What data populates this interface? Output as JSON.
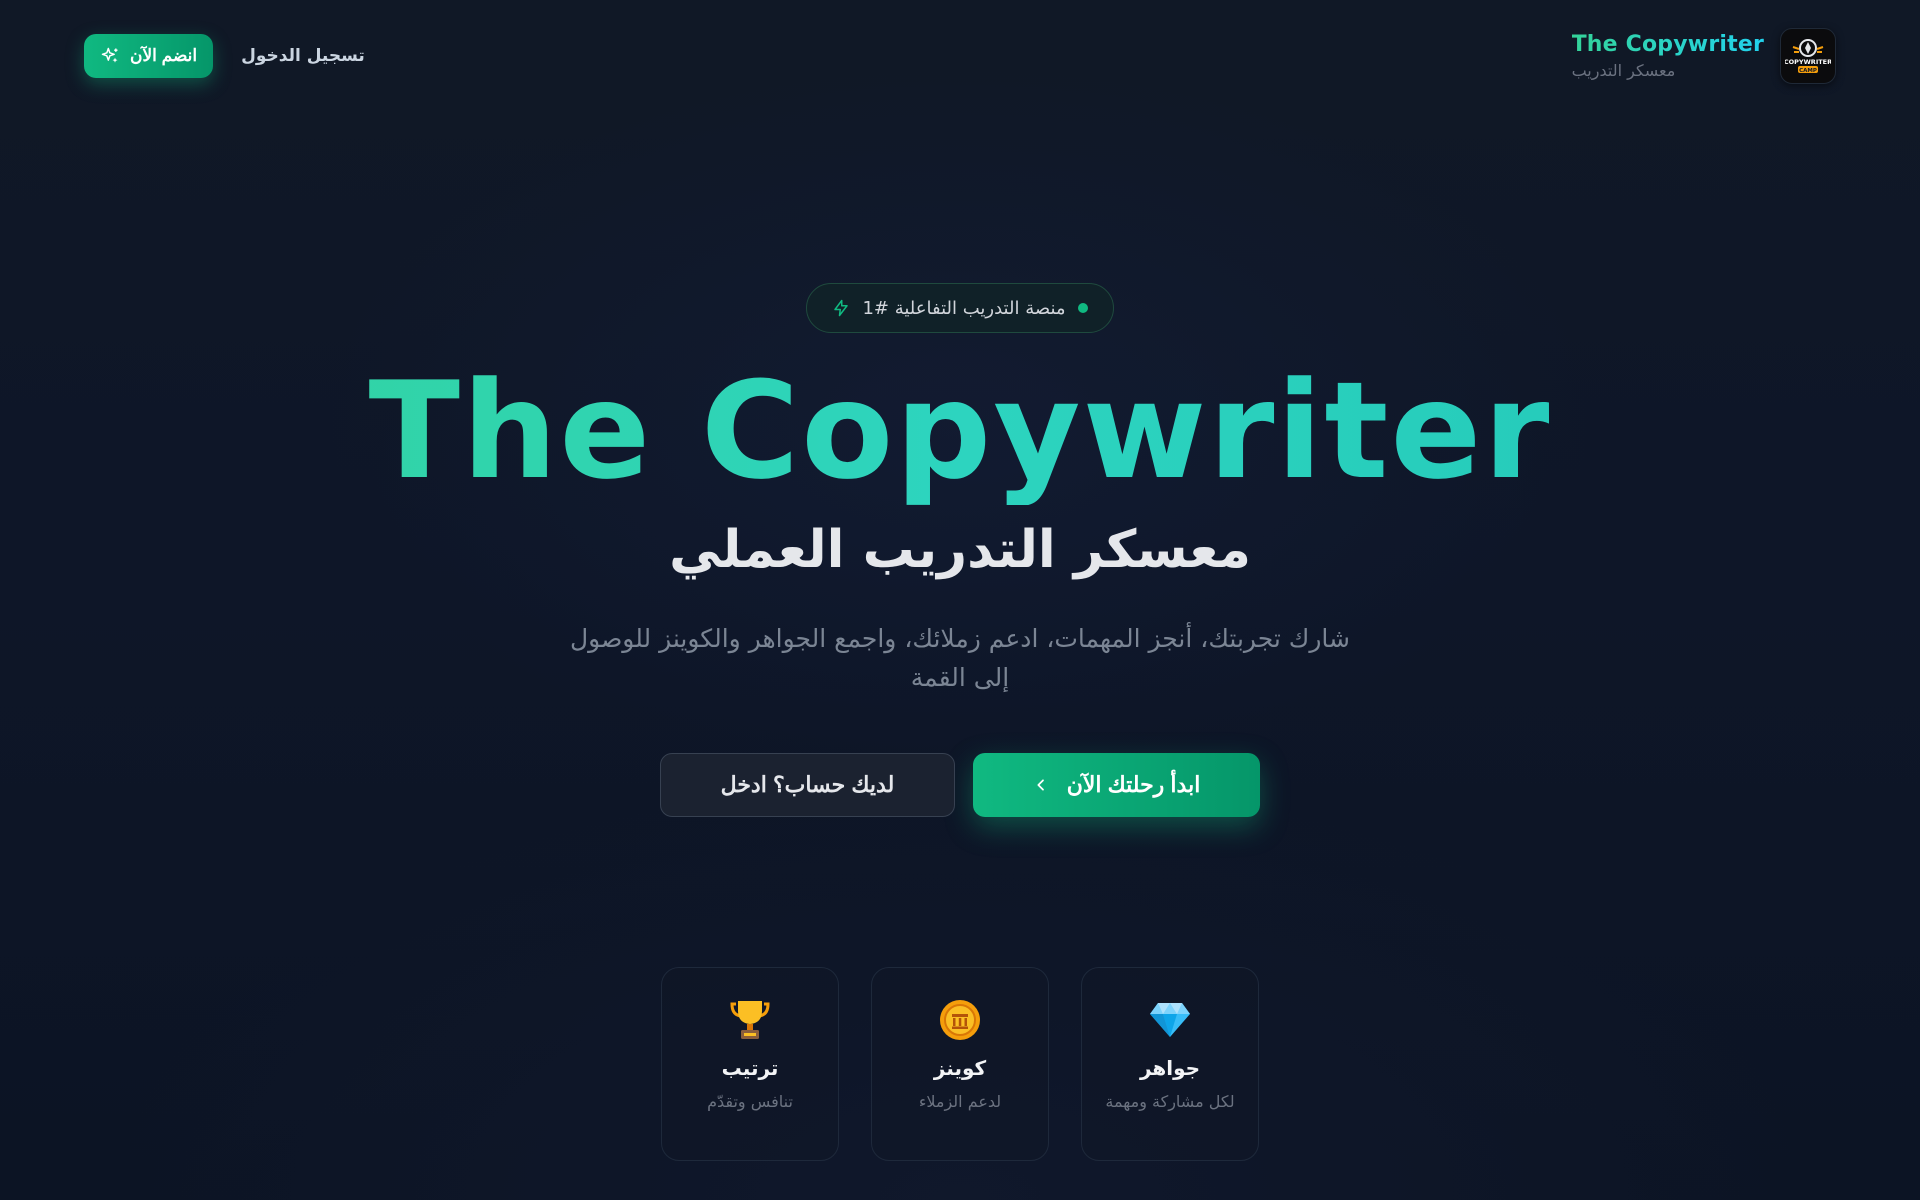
{
  "header": {
    "brand_title": "The Copywriter",
    "brand_subtitle": "معسكر التدريب",
    "logo_label": "COPYWRITER CAMP",
    "join_label": "انضم الآن",
    "login_label": "تسجيل الدخول"
  },
  "hero": {
    "badge": "منصة التدريب التفاعلية #1",
    "title": "The Copywriter",
    "subtitle": "معسكر التدريب العملي",
    "description": "شارك تجربتك، أنجز المهمات، ادعم زملائك، واجمع الجواهر والكوينز للوصول إلى القمة",
    "cta_primary": "ابدأ رحلتك الآن",
    "cta_secondary": "لديك حساب؟ ادخل"
  },
  "features": [
    {
      "icon": "gem-icon",
      "title": "جواهر",
      "desc": "لكل مشاركة ومهمة"
    },
    {
      "icon": "coin-icon",
      "title": "كوينز",
      "desc": "لدعم الزملاء"
    },
    {
      "icon": "trophy-icon",
      "title": "ترتيب",
      "desc": "تنافس وتقدّم"
    }
  ],
  "colors": {
    "accent": "#10b981",
    "accent_teal": "#2dd4bf",
    "background": "#0e1628"
  }
}
